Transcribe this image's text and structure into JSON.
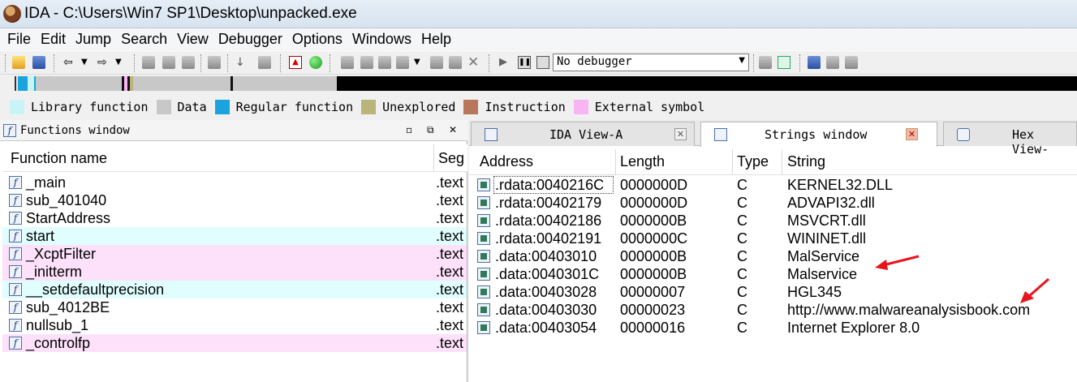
{
  "window": {
    "title": "IDA - C:\\Users\\Win7 SP1\\Desktop\\unpacked.exe"
  },
  "menu": [
    "File",
    "Edit",
    "Jump",
    "Search",
    "View",
    "Debugger",
    "Options",
    "Windows",
    "Help"
  ],
  "toolbar": {
    "debugger_value": "No debugger"
  },
  "legend": [
    {
      "label": "Library function",
      "color": "#c8f4f8"
    },
    {
      "label": "Data",
      "color": "#c8c8c8"
    },
    {
      "label": "Regular function",
      "color": "#1aa3dc"
    },
    {
      "label": "Unexplored",
      "color": "#b8b47a"
    },
    {
      "label": "Instruction",
      "color": "#b8765a"
    },
    {
      "label": "External symbol",
      "color": "#f9b4f4"
    }
  ],
  "functions_window": {
    "title": "Functions window",
    "columns": {
      "name": "Function name",
      "segment": "Seg"
    },
    "rows": [
      {
        "name": "_main",
        "segment": ".text",
        "kind": "regular"
      },
      {
        "name": "sub_401040",
        "segment": ".text",
        "kind": "regular"
      },
      {
        "name": "StartAddress",
        "segment": ".text",
        "kind": "regular"
      },
      {
        "name": "start",
        "segment": ".text",
        "kind": "library"
      },
      {
        "name": "_XcptFilter",
        "segment": ".text",
        "kind": "external"
      },
      {
        "name": "_initterm",
        "segment": ".text",
        "kind": "external"
      },
      {
        "name": "__setdefaultprecision",
        "segment": ".text",
        "kind": "library"
      },
      {
        "name": "sub_4012BE",
        "segment": ".text",
        "kind": "regular"
      },
      {
        "name": "nullsub_1",
        "segment": ".text",
        "kind": "regular"
      },
      {
        "name": "_controlfp",
        "segment": ".text",
        "kind": "external"
      }
    ]
  },
  "tabs": [
    {
      "label": "IDA View-A",
      "active": false
    },
    {
      "label": "Strings window",
      "active": true
    },
    {
      "label": "Hex View-",
      "active": false
    }
  ],
  "strings_window": {
    "columns": {
      "address": "Address",
      "length": "Length",
      "type": "Type",
      "string": "String"
    },
    "rows": [
      {
        "address": ".rdata:0040216C",
        "length": "0000000D",
        "type": "C",
        "string": "KERNEL32.DLL"
      },
      {
        "address": ".rdata:00402179",
        "length": "0000000D",
        "type": "C",
        "string": "ADVAPI32.dll"
      },
      {
        "address": ".rdata:00402186",
        "length": "0000000B",
        "type": "C",
        "string": "MSVCRT.dll"
      },
      {
        "address": ".rdata:00402191",
        "length": "0000000C",
        "type": "C",
        "string": "WININET.dll"
      },
      {
        "address": ".data:00403010",
        "length": "0000000B",
        "type": "C",
        "string": "MalService"
      },
      {
        "address": ".data:0040301C",
        "length": "0000000B",
        "type": "C",
        "string": "Malservice"
      },
      {
        "address": ".data:00403028",
        "length": "00000007",
        "type": "C",
        "string": "HGL345"
      },
      {
        "address": ".data:00403030",
        "length": "00000023",
        "type": "C",
        "string": "http://www.malwareanalysisbook.com"
      },
      {
        "address": ".data:00403054",
        "length": "00000016",
        "type": "C",
        "string": "Internet Explorer 8.0"
      }
    ]
  },
  "colors": {
    "library_row": "#e1fefe",
    "external_row": "#fde1fb",
    "annotation_arrow": "#e8141c"
  }
}
